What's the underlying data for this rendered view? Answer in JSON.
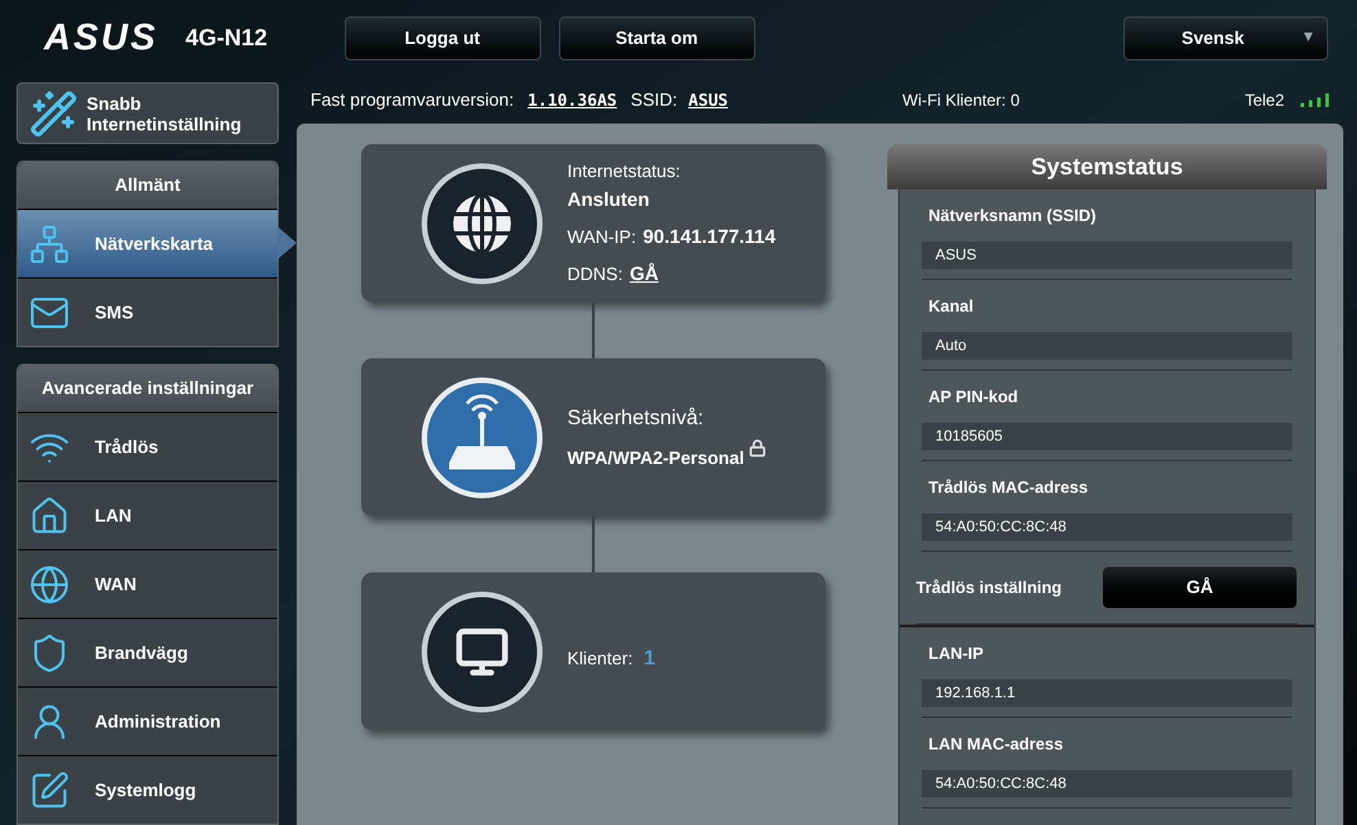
{
  "header": {
    "logo": "ASUS",
    "model": "4G-N12",
    "buttons": [
      "Logga ut",
      "Starta om"
    ],
    "language": "Svensk",
    "language_caret": "▼"
  },
  "info_bar": {
    "firmware_label": "Fast programvaruversion:",
    "firmware": "1.10.36AS",
    "ssid_label": "SSID:",
    "ssid": "ASUS",
    "wifi_clients": "Wi-Fi Klienter: 0",
    "operator": "Tele2"
  },
  "quick_setup": {
    "label": "Snabb Internetinställning"
  },
  "sidebar": {
    "groups": [
      {
        "title": "Allmänt",
        "items": [
          {
            "label": "Nätverkskarta",
            "selected": true
          },
          {
            "label": "SMS",
            "selected": false
          }
        ]
      },
      {
        "title": "Avancerade inställningar",
        "items": [
          {
            "label": "Trådlös",
            "selected": false
          },
          {
            "label": "LAN",
            "selected": false
          },
          {
            "label": "WAN",
            "selected": false
          },
          {
            "label": "Brandvägg",
            "selected": false
          },
          {
            "label": "Administration",
            "selected": false
          },
          {
            "label": "Systemlogg",
            "selected": false
          }
        ]
      }
    ]
  },
  "network_map": [
    {
      "kind": "internet",
      "lines": [
        {
          "label": "Internetstatus:",
          "value": "Ansluten",
          "kind": "stack"
        },
        {
          "label": "WAN-IP:",
          "value": "90.141.177.114",
          "kind": "inline"
        },
        {
          "label": "DDNS:",
          "value": "GÅ",
          "kind": "link"
        }
      ]
    },
    {
      "kind": "router",
      "lines": [
        {
          "label": "Säkerhetsnivå:",
          "value": "WPA/WPA2-Personal",
          "kind": "lock"
        }
      ]
    },
    {
      "kind": "clients",
      "lines": [
        {
          "label": "Klienter:",
          "value": "1",
          "kind": "count"
        }
      ]
    }
  ],
  "system_status": {
    "title": "Systemstatus",
    "sections": [
      {
        "rows": [
          {
            "kind": "field",
            "label": "Nätverksnamn (SSID)",
            "value": "ASUS"
          },
          {
            "kind": "field",
            "label": "Kanal",
            "value": "Auto"
          },
          {
            "kind": "field",
            "label": "AP PIN-kod",
            "value": "10185605"
          },
          {
            "kind": "field",
            "label": "Trådlös MAC-adress",
            "value": "54:A0:50:CC:8C:48"
          },
          {
            "kind": "button",
            "label": "Trådlös inställning",
            "value": "GÅ"
          }
        ]
      },
      {
        "rows": [
          {
            "kind": "field",
            "label": "LAN-IP",
            "value": "192.168.1.1"
          },
          {
            "kind": "field",
            "label": "LAN MAC-adress",
            "value": "54:A0:50:CC:8C:48"
          }
        ]
      }
    ]
  }
}
